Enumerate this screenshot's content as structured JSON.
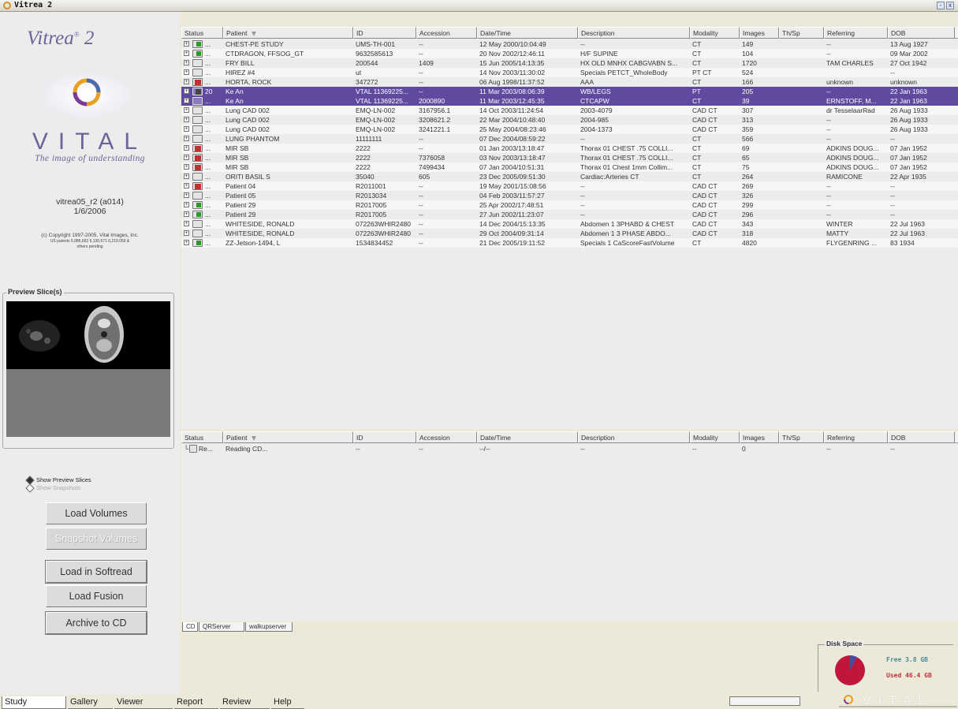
{
  "window": {
    "title": "Vitrea 2"
  },
  "brand": {
    "name": "Vitrea",
    "version_mark": "2",
    "company": "VITAL",
    "tagline": "The image of understanding",
    "build": "vitrea05_r2 (a014)",
    "build_date": "1/6/2006",
    "copyright": "(c) Copyright 1997-2005, Vital Images, Inc.",
    "patents": "US patents 5,986,662 6,130,671 6,219,059 &",
    "patents_2": "others pending"
  },
  "preview": {
    "label": "Preview Slice(s)",
    "show_preview": "Show Preview Slices",
    "show_snapshots": "Show Snapshots"
  },
  "actions": {
    "load_volumes": "Load Volumes",
    "snapshot_volumes": "Snapshot Volumes",
    "load_softread": "Load in Softread",
    "load_fusion": "Load Fusion",
    "archive_cd": "Archive to CD"
  },
  "columns": [
    "Status",
    "Patient",
    "ID",
    "Accession",
    "Date/Time",
    "Description",
    "Modality",
    "Images",
    "Th/Sp",
    "Referring",
    "DOB"
  ],
  "studies": [
    {
      "status": "green",
      "prefix": "...",
      "patient": "CHEST-PE STUDY",
      "id": "UMS-TH-001",
      "accession": "--",
      "datetime": "12 May 2000/10:04:49",
      "description": "--",
      "modality": "CT",
      "images": "149",
      "thsp": "",
      "referring": "--",
      "dob": "13 Aug 1927"
    },
    {
      "status": "green",
      "prefix": "...",
      "patient": "CTDRAGON, FFSOG_GT",
      "id": "9632585613",
      "accession": "--",
      "datetime": "20 Nov 2002/12:46:11",
      "description": "H/F SUPINE",
      "modality": "CT",
      "images": "104",
      "thsp": "",
      "referring": "--",
      "dob": "09 Mar 2002"
    },
    {
      "status": "gray",
      "prefix": "...",
      "patient": "FRY BILL",
      "id": "200544",
      "accession": "1409",
      "datetime": "15 Jun 2005/14:13:35",
      "description": "HX OLD MNHX CABGVABN S...",
      "modality": "CT",
      "images": "1720",
      "thsp": "",
      "referring": "TAM CHARLES",
      "dob": "27 Oct 1942"
    },
    {
      "status": "gray",
      "prefix": "...",
      "patient": "HIREZ #4",
      "id": "ut",
      "accession": "--",
      "datetime": "14 Nov 2003/11:30:02",
      "description": "Specials PETCT_WholeBody",
      "modality": "PT CT",
      "images": "524",
      "thsp": "",
      "referring": "",
      "dob": "--"
    },
    {
      "status": "red",
      "prefix": "...",
      "patient": "HORTA, ROCK",
      "id": "347272",
      "accession": "--",
      "datetime": "06 Aug 1998/11:37:52",
      "description": "AAA",
      "modality": "CT",
      "images": "166",
      "thsp": "",
      "referring": "unknown",
      "dob": "unknown"
    },
    {
      "status": "dark",
      "prefix": "20",
      "patient": "Ke An",
      "id": "VTAL 11369225...",
      "accession": "--",
      "datetime": "11 Mar 2003/08:06:39",
      "description": "WB/LEGS",
      "modality": "PT",
      "images": "205",
      "thsp": "",
      "referring": "--",
      "dob": "22 Jan 1963",
      "selected": true
    },
    {
      "status": "gray",
      "prefix": "...",
      "patient": "Ke An",
      "id": "VTAL 11369225...",
      "accession": "2000890",
      "datetime": "11 Mar 2003/12:45:35",
      "description": "CTCAPW",
      "modality": "CT",
      "images": "39",
      "thsp": "",
      "referring": "ERNSTOFF, M...",
      "dob": "22 Jan 1963",
      "selected": true
    },
    {
      "status": "gray",
      "prefix": "...",
      "patient": "Lung CAD 002",
      "id": "EMQ-LN-002",
      "accession": "3167956.1",
      "datetime": "14 Oct 2003/11:24:54",
      "description": "2003-4079",
      "modality": "CAD CT",
      "images": "307",
      "thsp": "",
      "referring": "dr TesselaarRad",
      "dob": "26 Aug 1933"
    },
    {
      "status": "gray",
      "prefix": "...",
      "patient": "Lung CAD 002",
      "id": "EMQ-LN-002",
      "accession": "3208621.2",
      "datetime": "22 Mar 2004/10:48:40",
      "description": "2004-985",
      "modality": "CAD CT",
      "images": "313",
      "thsp": "",
      "referring": "--",
      "dob": "26 Aug 1933"
    },
    {
      "status": "gray",
      "prefix": "...",
      "patient": "Lung CAD 002",
      "id": "EMQ-LN-002",
      "accession": "3241221.1",
      "datetime": "25 May 2004/08:23:46",
      "description": "2004-1373",
      "modality": "CAD CT",
      "images": "359",
      "thsp": "",
      "referring": "--",
      "dob": "26 Aug 1933"
    },
    {
      "status": "gray",
      "prefix": "...",
      "patient": "LUNG PHANTOM",
      "id": "11111111",
      "accession": "--",
      "datetime": "07 Dec 2004/08:59:22",
      "description": "--",
      "modality": "CT",
      "images": "566",
      "thsp": "",
      "referring": "--",
      "dob": "--"
    },
    {
      "status": "red",
      "prefix": "...",
      "patient": "MIR SB",
      "id": "2222",
      "accession": "--",
      "datetime": "01 Jan 2003/13:18:47",
      "description": "Thorax 01 CHEST .75 COLLI...",
      "modality": "CT",
      "images": "69",
      "thsp": "",
      "referring": "ADKINS DOUG...",
      "dob": "07 Jan 1952"
    },
    {
      "status": "red",
      "prefix": "...",
      "patient": "MIR SB",
      "id": "2222",
      "accession": "7376058",
      "datetime": "03 Nov 2003/13:18:47",
      "description": "Thorax 01 CHEST .75 COLLI...",
      "modality": "CT",
      "images": "65",
      "thsp": "",
      "referring": "ADKINS DOUG...",
      "dob": "07 Jan 1952"
    },
    {
      "status": "red",
      "prefix": "...",
      "patient": "MIR SB",
      "id": "2222",
      "accession": "7499434",
      "datetime": "07 Jan 2004/10:51:31",
      "description": "Thorax 01 Chest 1mm Collim...",
      "modality": "CT",
      "images": "75",
      "thsp": "",
      "referring": "ADKINS DOUG...",
      "dob": "07 Jan 1952"
    },
    {
      "status": "gray",
      "prefix": "...",
      "patient": "ORITI BASIL S",
      "id": "35040",
      "accession": "605",
      "datetime": "23 Dec 2005/09:51:30",
      "description": "Cardiac:Arteries CT",
      "modality": "CT",
      "images": "264",
      "thsp": "",
      "referring": "RAMICONE",
      "dob": "22 Apr 1935"
    },
    {
      "status": "red",
      "prefix": "...",
      "patient": "Patient 04",
      "id": "R2011001",
      "accession": "--",
      "datetime": "19 May 2001/15:08:56",
      "description": "--",
      "modality": "CAD CT",
      "images": "269",
      "thsp": "",
      "referring": "--",
      "dob": "--"
    },
    {
      "status": "gray",
      "prefix": "...",
      "patient": "Patient 05",
      "id": "R2013034",
      "accession": "--",
      "datetime": "04 Feb 2003/11:57:27",
      "description": "--",
      "modality": "CAD CT",
      "images": "326",
      "thsp": "",
      "referring": "--",
      "dob": "--"
    },
    {
      "status": "green",
      "prefix": "...",
      "patient": "Patient 29",
      "id": "R2017005",
      "accession": "--",
      "datetime": "25 Apr 2002/17:48:51",
      "description": "--",
      "modality": "CAD CT",
      "images": "299",
      "thsp": "",
      "referring": "--",
      "dob": "--"
    },
    {
      "status": "green",
      "prefix": "...",
      "patient": "Patient 29",
      "id": "R2017005",
      "accession": "--",
      "datetime": "27 Jun 2002/11:23:07",
      "description": "--",
      "modality": "CAD CT",
      "images": "296",
      "thsp": "",
      "referring": "--",
      "dob": "--"
    },
    {
      "status": "gray",
      "prefix": "...",
      "patient": "WHITESIDE, RONALD",
      "id": "072263WHIR2480",
      "accession": "--",
      "datetime": "14 Dec 2004/15:13:35",
      "description": "Abdomen 1 3PHABD & CHEST",
      "modality": "CAD CT",
      "images": "343",
      "thsp": "",
      "referring": "WINTER",
      "dob": "22 Jul 1963"
    },
    {
      "status": "gray",
      "prefix": "...",
      "patient": "WHITESIDE, RONALD",
      "id": "072263WHIR2480",
      "accession": "--",
      "datetime": "29 Oct 2004/09:31:14",
      "description": "Abdomen 1 3 PHASE ABDO...",
      "modality": "CAD CT",
      "images": "318",
      "thsp": "",
      "referring": "MATTY",
      "dob": "22 Jul 1963"
    },
    {
      "status": "green",
      "prefix": "...",
      "patient": "ZZ-Jetson-1494, L",
      "id": "1534834452",
      "accession": "--",
      "datetime": "21 Dec 2005/19:11:52",
      "description": "Specials 1 CaScoreFastVolume",
      "modality": "CT",
      "images": "4820",
      "thsp": "",
      "referring": "FLYGENRING ...",
      "dob": "83 1934"
    }
  ],
  "cd_rows": [
    {
      "status": "Re...",
      "patient": "Reading CD...",
      "id": "--",
      "accession": "--",
      "datetime": "--/--",
      "description": "--",
      "modality": "--",
      "images": "0",
      "thsp": "",
      "referring": "--",
      "dob": "--"
    }
  ],
  "source_tabs": [
    "CD",
    "QRServer",
    "walkupserver"
  ],
  "main_tabs": [
    "Study Directory",
    "Gallery",
    "Viewer",
    "Report",
    "Review",
    "Help"
  ],
  "disk": {
    "label": "Disk Space",
    "free": "Free  3.8 GB",
    "used": "Used  46.4 GB",
    "free_gb": 3.8,
    "used_gb": 46.4
  },
  "colors": {
    "selected_row": "#5f4aa0",
    "brand": "#6a6598",
    "disk_used": "#c0163c",
    "disk_free": "#4e4aa0"
  }
}
